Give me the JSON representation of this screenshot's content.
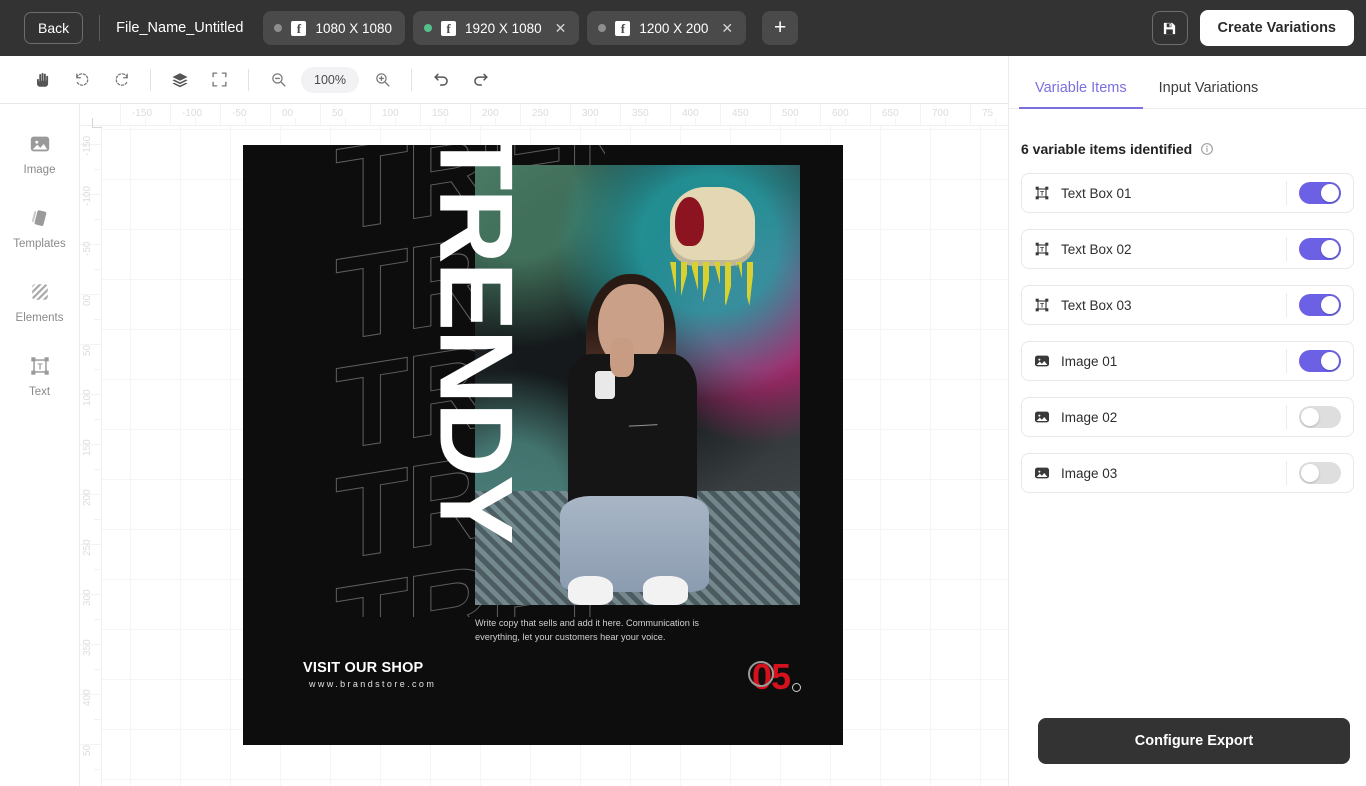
{
  "topbar": {
    "back_label": "Back",
    "filename": "File_Name_Untitled",
    "formats": [
      {
        "label": "1080 X 1080",
        "active": false,
        "closable": false,
        "icon": "facebook-icon"
      },
      {
        "label": "1920 X 1080",
        "active": true,
        "closable": true,
        "icon": "facebook-icon"
      },
      {
        "label": "1200 X 200",
        "active": false,
        "closable": true,
        "icon": "facebook-icon"
      }
    ],
    "add_format_label": "+",
    "save_icon": "save-disk-icon",
    "create_variations_label": "Create Variations"
  },
  "toolbar": {
    "tools": [
      {
        "name": "hand-tool-icon"
      },
      {
        "name": "rotate-left-icon"
      },
      {
        "name": "rotate-right-icon"
      },
      {
        "name": "layers-icon"
      },
      {
        "name": "fit-to-screen-icon"
      },
      {
        "name": "zoom-out-icon"
      },
      {
        "name": "zoom-in-icon"
      },
      {
        "name": "undo-icon"
      },
      {
        "name": "redo-icon"
      }
    ],
    "zoom_level": "100%"
  },
  "rail": {
    "items": [
      {
        "label": "Image",
        "icon": "image-icon"
      },
      {
        "label": "Templates",
        "icon": "templates-icon"
      },
      {
        "label": "Elements",
        "icon": "elements-icon"
      },
      {
        "label": "Text",
        "icon": "text-box-icon"
      }
    ]
  },
  "ruler": {
    "h_ticks": [
      "-150",
      "-100",
      "-50",
      "00",
      "50",
      "100",
      "150",
      "200",
      "250",
      "300",
      "350",
      "400",
      "450",
      "500",
      "600",
      "650",
      "700",
      "75"
    ],
    "v_ticks": [
      "-150",
      "-100",
      "-50",
      "00",
      "50",
      "100",
      "150",
      "200",
      "250",
      "300",
      "350",
      "400",
      "50"
    ]
  },
  "artboard": {
    "background_color": "#0d0d0d",
    "ghost_text_lines": [
      "TREND",
      "TREND",
      "TREND",
      "TREND",
      "TREND"
    ],
    "headline": "TRENDY",
    "body_copy": "Write copy that sells and add it here. Communication is everything, let your customers hear your voice.",
    "visit_title": "VISIT OUR SHOP",
    "visit_url": "www.brandstore.com",
    "number_badge": "05",
    "accent_color": "#d4111c"
  },
  "panel": {
    "tabs": [
      {
        "label": "Variable Items",
        "active": true
      },
      {
        "label": "Input Variations",
        "active": false
      }
    ],
    "accent_color": "#7b6fe0",
    "summary": "6 variable items identified",
    "info_icon": "info-icon",
    "items": [
      {
        "label": "Text Box 01",
        "icon": "text-box-icon",
        "enabled": true
      },
      {
        "label": "Text Box 02",
        "icon": "text-box-icon",
        "enabled": true
      },
      {
        "label": "Text Box 03",
        "icon": "text-box-icon",
        "enabled": true
      },
      {
        "label": "Image 01",
        "icon": "image-icon",
        "enabled": true
      },
      {
        "label": "Image 02",
        "icon": "image-icon",
        "enabled": false
      },
      {
        "label": "Image 03",
        "icon": "image-icon",
        "enabled": false
      }
    ],
    "configure_export_label": "Configure Export"
  }
}
